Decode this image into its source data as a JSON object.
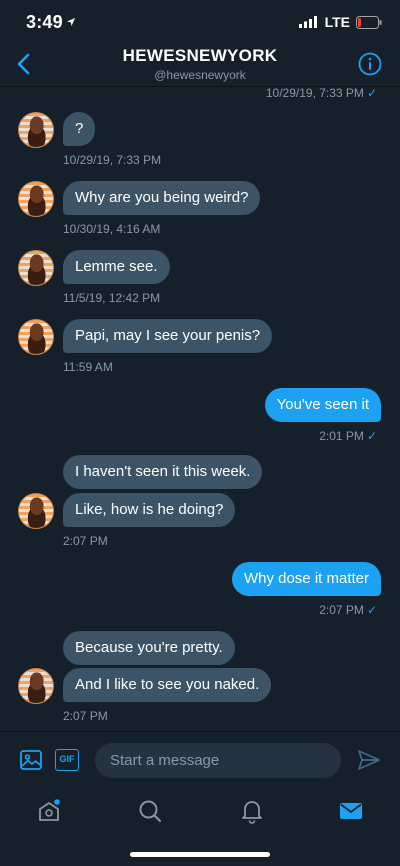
{
  "status_bar": {
    "time": "3:49",
    "network": "LTE"
  },
  "header": {
    "title": "HEWESNEWYORK",
    "handle": "@hewesnewyork"
  },
  "messages": [
    {
      "type": "meta_out",
      "text": "10/29/19, 7:33 PM"
    },
    {
      "type": "in",
      "text": "?"
    },
    {
      "type": "meta_in",
      "text": "10/29/19, 7:33 PM"
    },
    {
      "type": "in",
      "text": "Why are you being weird?"
    },
    {
      "type": "meta_in",
      "text": "10/30/19, 4:16 AM"
    },
    {
      "type": "in",
      "text": "Lemme see."
    },
    {
      "type": "meta_in",
      "text": "11/5/19, 12:42 PM"
    },
    {
      "type": "in",
      "text": "Papi, may I see your penis?"
    },
    {
      "type": "meta_in",
      "text": "11:59 AM"
    },
    {
      "type": "out",
      "text": "You've seen it"
    },
    {
      "type": "meta_out",
      "text": "2:01 PM"
    },
    {
      "type": "in",
      "text": "I haven't seen it this week."
    },
    {
      "type": "in",
      "text": "Like, how is he doing?"
    },
    {
      "type": "meta_in",
      "text": "2:07 PM"
    },
    {
      "type": "out",
      "text": "Why dose it matter"
    },
    {
      "type": "meta_out",
      "text": "2:07 PM"
    },
    {
      "type": "in",
      "text": "Because you're pretty."
    },
    {
      "type": "in",
      "text": "And I like to see you naked."
    },
    {
      "type": "meta_in",
      "text": "2:07 PM"
    }
  ],
  "compose": {
    "placeholder": "Start a message",
    "gif_label": "GIF"
  },
  "icons": {
    "back": "chevron-left-icon",
    "info": "info-icon",
    "image": "image-icon",
    "gif": "gif-icon",
    "send": "send-icon",
    "home": "home-icon",
    "search": "search-icon",
    "notifications": "bell-icon",
    "messages": "envelope-icon"
  },
  "colors": {
    "background": "#15202b",
    "accent": "#1da1f2",
    "incoming_bubble": "#3d5466",
    "secondary_text": "#8899a6"
  }
}
